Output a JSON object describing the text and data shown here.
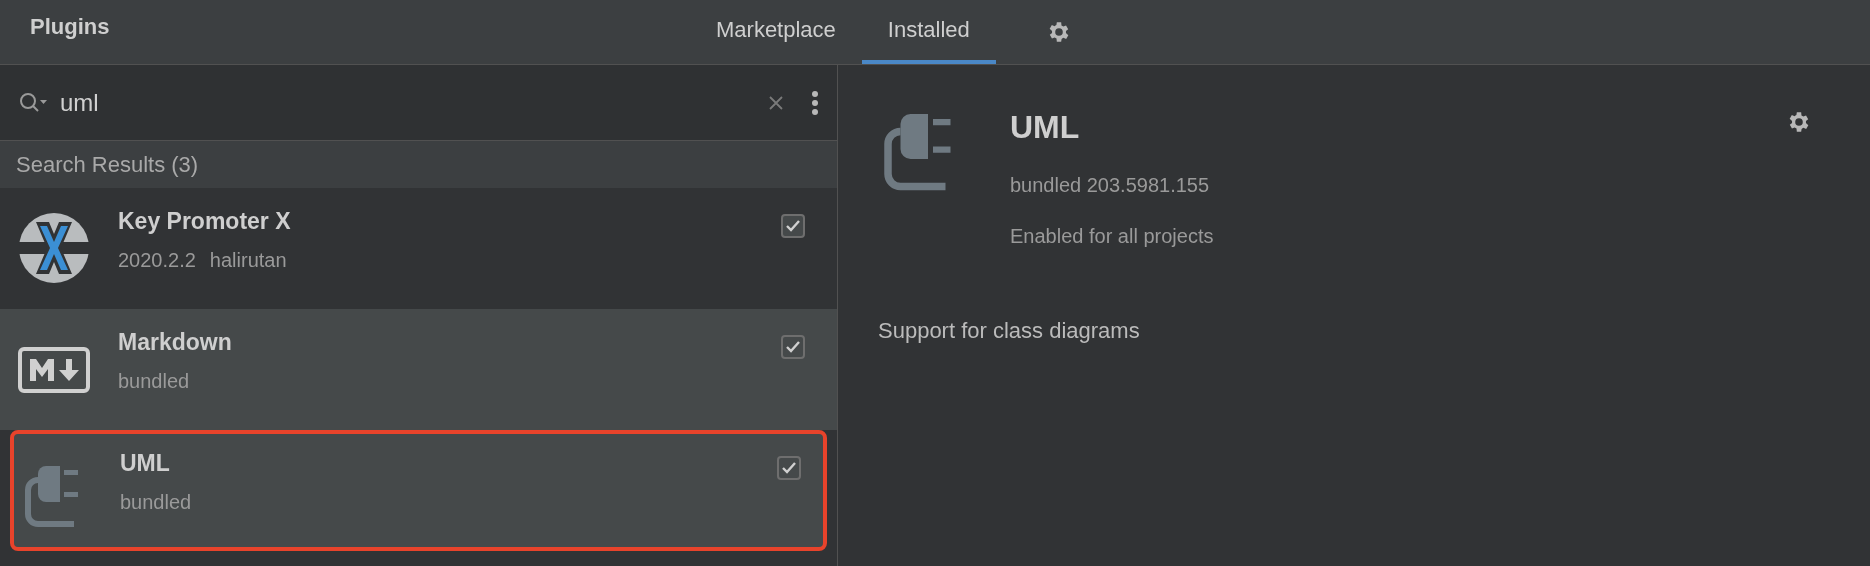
{
  "window": {
    "title": "Plugins"
  },
  "tabs": [
    {
      "label": "Marketplace",
      "selected": false
    },
    {
      "label": "Installed",
      "selected": true
    }
  ],
  "search": {
    "value": "uml"
  },
  "results_header": "Search Results (3)",
  "plugins": [
    {
      "kind": "keypromoter",
      "name": "Key Promoter X",
      "version": "2020.2.2",
      "vendor": "halirutan",
      "checked": true,
      "shaded": false,
      "selected": false
    },
    {
      "kind": "markdown",
      "name": "Markdown",
      "version": "bundled",
      "checked": true,
      "shaded": true,
      "selected": false
    },
    {
      "kind": "plug",
      "name": "UML",
      "version": "bundled",
      "checked": true,
      "shaded": true,
      "selected": true
    }
  ],
  "details": {
    "kind": "plug",
    "name": "UML",
    "version": "bundled 203.5981.155",
    "status": "Enabled for all projects",
    "description": "Support for class diagrams"
  }
}
